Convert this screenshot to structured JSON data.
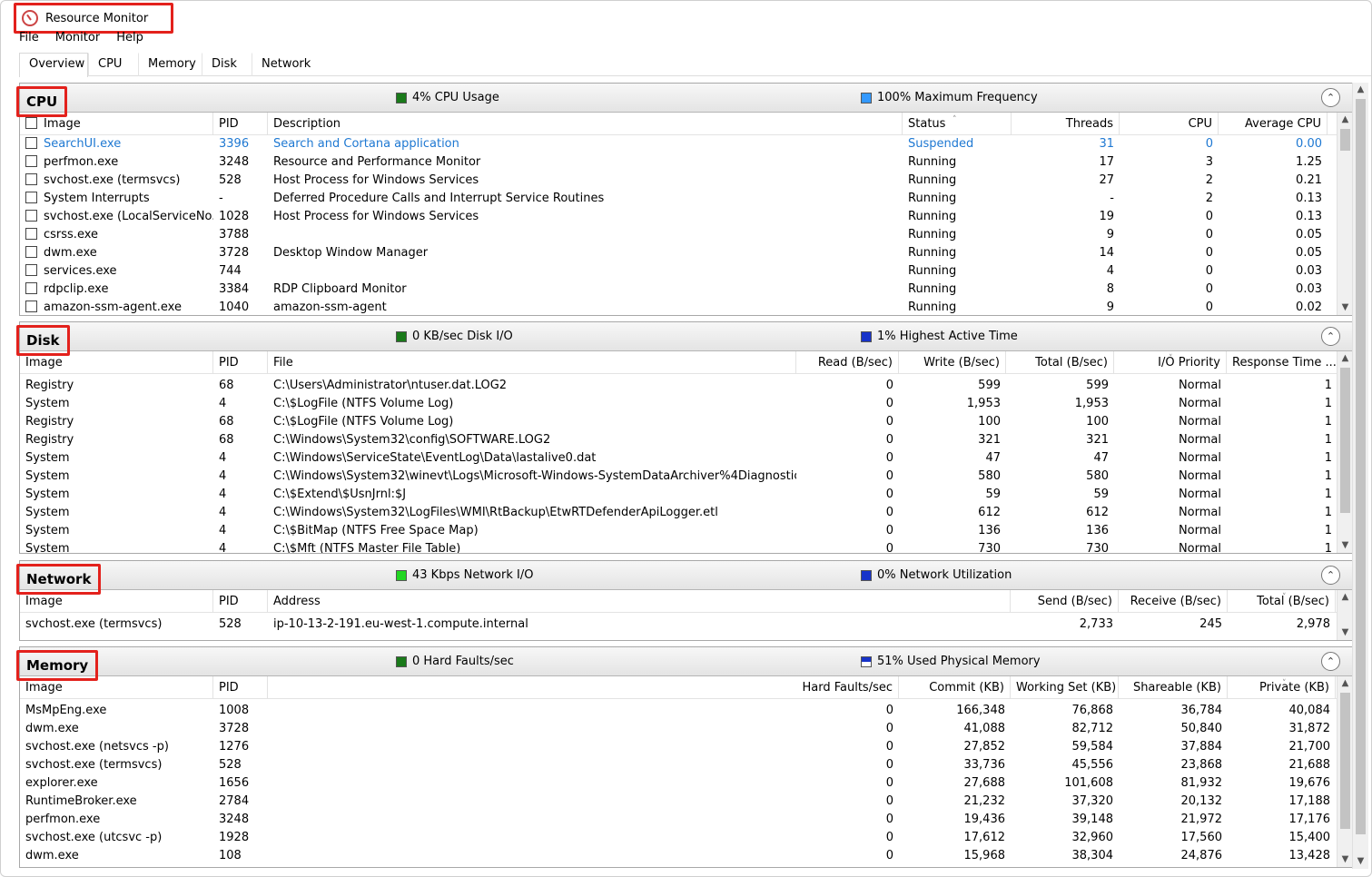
{
  "window": {
    "title": "Resource Monitor"
  },
  "menu": [
    "File",
    "Monitor",
    "Help"
  ],
  "tabs": [
    "Overview",
    "CPU",
    "Memory",
    "Disk",
    "Network"
  ],
  "colors": {
    "accent_blue": "#1e78d2",
    "highlight_red": "#e3211c",
    "cpu_green": "#1a7a1a",
    "net_green": "#22d622",
    "freq_blue": "#3399ff",
    "dark_blue": "#1733c9"
  },
  "cpu": {
    "title": "CPU",
    "stat1": "4% CPU Usage",
    "stat2": "100% Maximum Frequency",
    "columns": [
      "Image",
      "PID",
      "Description",
      "Status",
      "Threads",
      "CPU",
      "Average CPU"
    ],
    "rows": [
      [
        "SearchUI.exe",
        "3396",
        "Search and Cortana application",
        "Suspended",
        "31",
        "0",
        "0.00"
      ],
      [
        "perfmon.exe",
        "3248",
        "Resource and Performance Monitor",
        "Running",
        "17",
        "3",
        "1.25"
      ],
      [
        "svchost.exe (termsvcs)",
        "528",
        "Host Process for Windows Services",
        "Running",
        "27",
        "2",
        "0.21"
      ],
      [
        "System Interrupts",
        "-",
        "Deferred Procedure Calls and Interrupt Service Routines",
        "Running",
        "-",
        "2",
        "0.13"
      ],
      [
        "svchost.exe (LocalServiceNo...",
        "1028",
        "Host Process for Windows Services",
        "Running",
        "19",
        "0",
        "0.13"
      ],
      [
        "csrss.exe",
        "3788",
        "",
        "Running",
        "9",
        "0",
        "0.05"
      ],
      [
        "dwm.exe",
        "3728",
        "Desktop Window Manager",
        "Running",
        "14",
        "0",
        "0.05"
      ],
      [
        "services.exe",
        "744",
        "",
        "Running",
        "4",
        "0",
        "0.03"
      ],
      [
        "rdpclip.exe",
        "3384",
        "RDP Clipboard Monitor",
        "Running",
        "8",
        "0",
        "0.03"
      ],
      [
        "amazon-ssm-agent.exe",
        "1040",
        "amazon-ssm-agent",
        "Running",
        "9",
        "0",
        "0.02"
      ]
    ]
  },
  "disk": {
    "title": "Disk",
    "stat1": "0 KB/sec Disk I/O",
    "stat2": "1% Highest Active Time",
    "columns": [
      "Image",
      "PID",
      "File",
      "Read (B/sec)",
      "Write (B/sec)",
      "Total (B/sec)",
      "I/O Priority",
      "Response Time ..."
    ],
    "rows": [
      [
        "Registry",
        "68",
        "C:\\Users\\Administrator\\ntuser.dat.LOG2",
        "0",
        "599",
        "599",
        "Normal",
        "1"
      ],
      [
        "System",
        "4",
        "C:\\$LogFile (NTFS Volume Log)",
        "0",
        "1,953",
        "1,953",
        "Normal",
        "1"
      ],
      [
        "Registry",
        "68",
        "C:\\$LogFile (NTFS Volume Log)",
        "0",
        "100",
        "100",
        "Normal",
        "1"
      ],
      [
        "Registry",
        "68",
        "C:\\Windows\\System32\\config\\SOFTWARE.LOG2",
        "0",
        "321",
        "321",
        "Normal",
        "1"
      ],
      [
        "System",
        "4",
        "C:\\Windows\\ServiceState\\EventLog\\Data\\lastalive0.dat",
        "0",
        "47",
        "47",
        "Normal",
        "1"
      ],
      [
        "System",
        "4",
        "C:\\Windows\\System32\\winevt\\Logs\\Microsoft-Windows-SystemDataArchiver%4Diagnostic....",
        "0",
        "580",
        "580",
        "Normal",
        "1"
      ],
      [
        "System",
        "4",
        "C:\\$Extend\\$UsnJrnl:$J",
        "0",
        "59",
        "59",
        "Normal",
        "1"
      ],
      [
        "System",
        "4",
        "C:\\Windows\\System32\\LogFiles\\WMI\\RtBackup\\EtwRTDefenderApiLogger.etl",
        "0",
        "612",
        "612",
        "Normal",
        "1"
      ],
      [
        "System",
        "4",
        "C:\\$BitMap (NTFS Free Space Map)",
        "0",
        "136",
        "136",
        "Normal",
        "1"
      ],
      [
        "System",
        "4",
        "C:\\$Mft (NTFS Master File Table)",
        "0",
        "730",
        "730",
        "Normal",
        "1"
      ]
    ]
  },
  "network": {
    "title": "Network",
    "stat1": "43 Kbps Network I/O",
    "stat2": "0% Network Utilization",
    "columns": [
      "Image",
      "PID",
      "Address",
      "Send (B/sec)",
      "Receive (B/sec)",
      "Total (B/sec)"
    ],
    "rows": [
      [
        "svchost.exe (termsvcs)",
        "528",
        "ip-10-13-2-191.eu-west-1.compute.internal",
        "2,733",
        "245",
        "2,978"
      ]
    ]
  },
  "memory": {
    "title": "Memory",
    "stat1": "0 Hard Faults/sec",
    "stat2": "51% Used Physical Memory",
    "columns": [
      "Image",
      "PID",
      "Hard Faults/sec",
      "Commit (KB)",
      "Working Set (KB)",
      "Shareable (KB)",
      "Private (KB)"
    ],
    "rows": [
      [
        "MsMpEng.exe",
        "1008",
        "0",
        "166,348",
        "76,868",
        "36,784",
        "40,084"
      ],
      [
        "dwm.exe",
        "3728",
        "0",
        "41,088",
        "82,712",
        "50,840",
        "31,872"
      ],
      [
        "svchost.exe (netsvcs -p)",
        "1276",
        "0",
        "27,852",
        "59,584",
        "37,884",
        "21,700"
      ],
      [
        "svchost.exe (termsvcs)",
        "528",
        "0",
        "33,736",
        "45,556",
        "23,868",
        "21,688"
      ],
      [
        "explorer.exe",
        "1656",
        "0",
        "27,688",
        "101,608",
        "81,932",
        "19,676"
      ],
      [
        "RuntimeBroker.exe",
        "2784",
        "0",
        "21,232",
        "37,320",
        "20,132",
        "17,188"
      ],
      [
        "perfmon.exe",
        "3248",
        "0",
        "19,436",
        "39,148",
        "21,972",
        "17,176"
      ],
      [
        "svchost.exe (utcsvc -p)",
        "1928",
        "0",
        "17,612",
        "32,960",
        "17,560",
        "15,400"
      ],
      [
        "dwm.exe",
        "108",
        "0",
        "15,968",
        "38,304",
        "24,876",
        "13,428"
      ]
    ]
  }
}
